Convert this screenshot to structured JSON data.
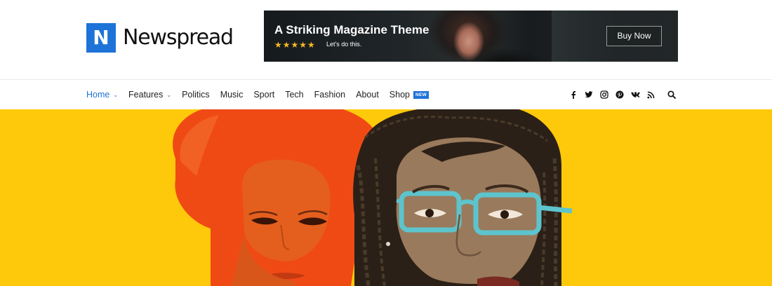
{
  "site": {
    "logo_letter": "N",
    "logo_text": "Newspread",
    "brand_color": "#1e73d8"
  },
  "banner": {
    "title": "A Striking Magazine Theme",
    "stars": "★★★★★",
    "subtitle": "Let's do this.",
    "button_label": "Buy Now"
  },
  "nav": {
    "items": [
      {
        "label": "Home",
        "active": true,
        "dropdown": true
      },
      {
        "label": "Features",
        "dropdown": true
      },
      {
        "label": "Politics"
      },
      {
        "label": "Music"
      },
      {
        "label": "Sport"
      },
      {
        "label": "Tech"
      },
      {
        "label": "Fashion"
      },
      {
        "label": "About"
      },
      {
        "label": "Shop",
        "badge": "NEW"
      }
    ],
    "social_icons": [
      "facebook-icon",
      "twitter-icon",
      "instagram-icon",
      "pinterest-icon",
      "vk-icon",
      "rss-icon",
      "search-icon"
    ]
  },
  "hero": {
    "background_color": "#fec90a"
  }
}
